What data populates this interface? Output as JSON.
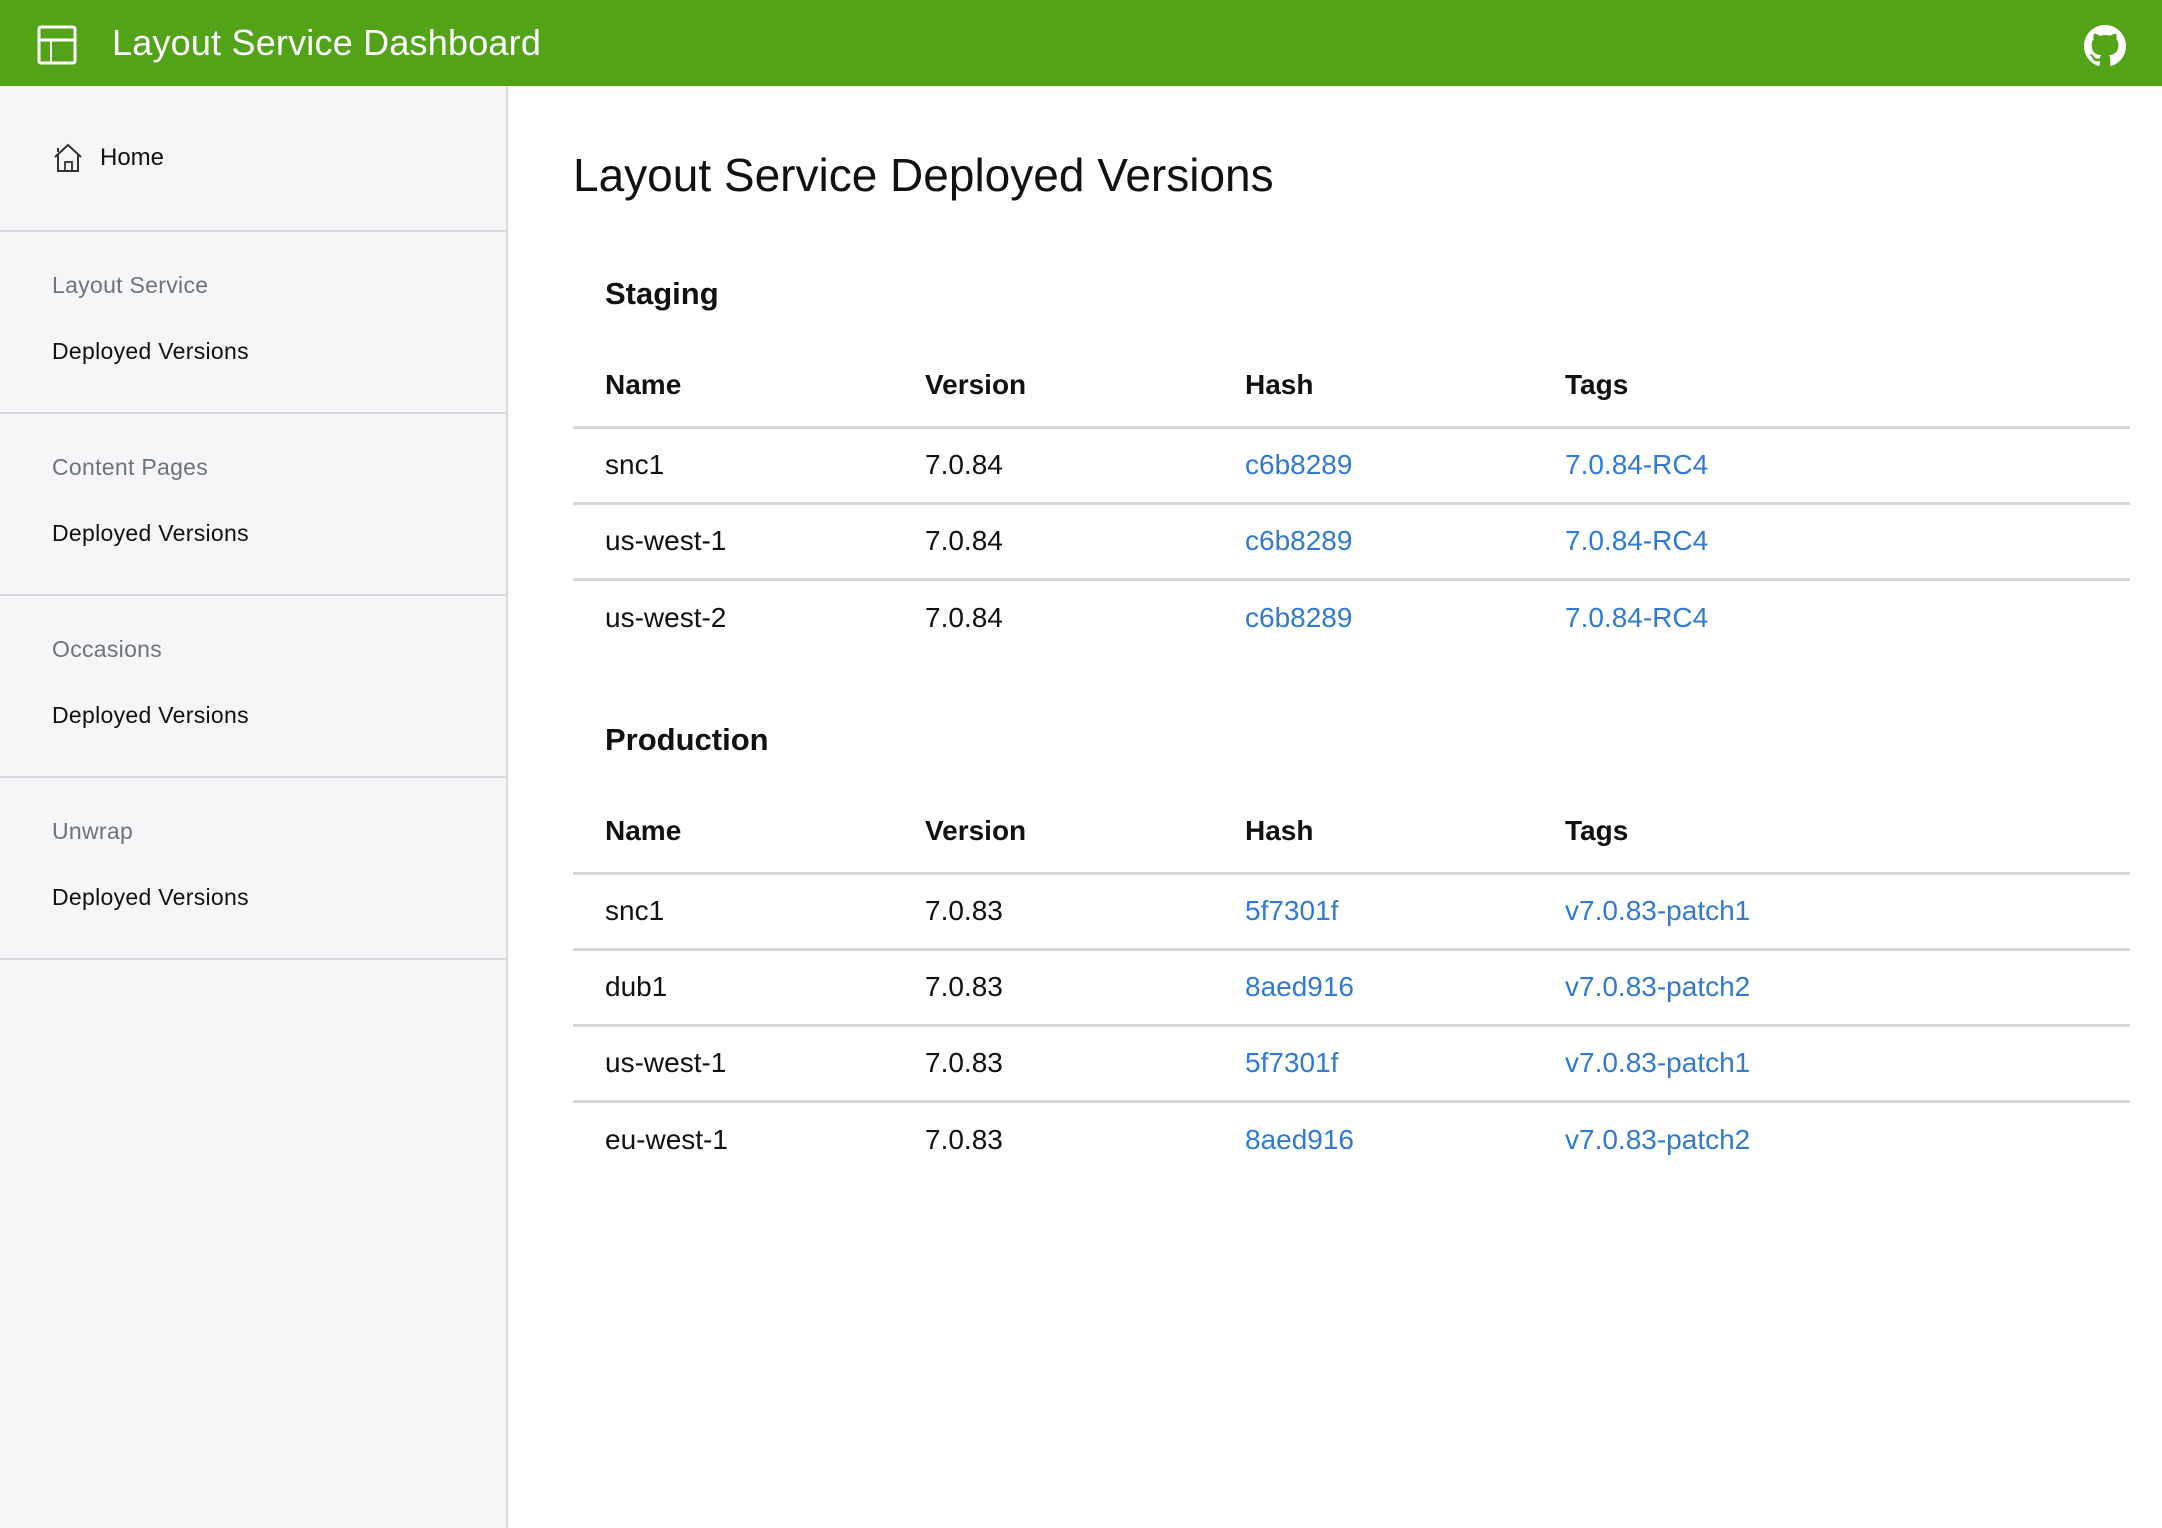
{
  "header": {
    "title": "Layout Service Dashboard",
    "logo_icon": "layout-icon",
    "github_icon": "github-icon",
    "brand_color": "#53a319"
  },
  "sidebar": {
    "home": {
      "label": "Home",
      "icon": "home-icon"
    },
    "sections": [
      {
        "category": "Layout Service",
        "link": "Deployed Versions"
      },
      {
        "category": "Content Pages",
        "link": "Deployed Versions"
      },
      {
        "category": "Occasions",
        "link": "Deployed Versions"
      },
      {
        "category": "Unwrap",
        "link": "Deployed Versions"
      }
    ]
  },
  "main": {
    "title": "Layout Service Deployed Versions",
    "columns": [
      "Name",
      "Version",
      "Hash",
      "Tags"
    ],
    "staging": {
      "title": "Staging",
      "rows": [
        {
          "name": "snc1",
          "version": "7.0.84",
          "hash": "c6b8289",
          "tag": "7.0.84-RC4"
        },
        {
          "name": "us-west-1",
          "version": "7.0.84",
          "hash": "c6b8289",
          "tag": "7.0.84-RC4"
        },
        {
          "name": "us-west-2",
          "version": "7.0.84",
          "hash": "c6b8289",
          "tag": "7.0.84-RC4"
        }
      ]
    },
    "production": {
      "title": "Production",
      "rows": [
        {
          "name": "snc1",
          "version": "7.0.83",
          "hash": "5f7301f",
          "tag": "v7.0.83-patch1"
        },
        {
          "name": "dub1",
          "version": "7.0.83",
          "hash": "8aed916",
          "tag": "v7.0.83-patch2"
        },
        {
          "name": "us-west-1",
          "version": "7.0.83",
          "hash": "5f7301f",
          "tag": "v7.0.83-patch1"
        },
        {
          "name": "eu-west-1",
          "version": "7.0.83",
          "hash": "8aed916",
          "tag": "v7.0.83-patch2"
        }
      ]
    },
    "link_color": "#2e7bd1"
  }
}
